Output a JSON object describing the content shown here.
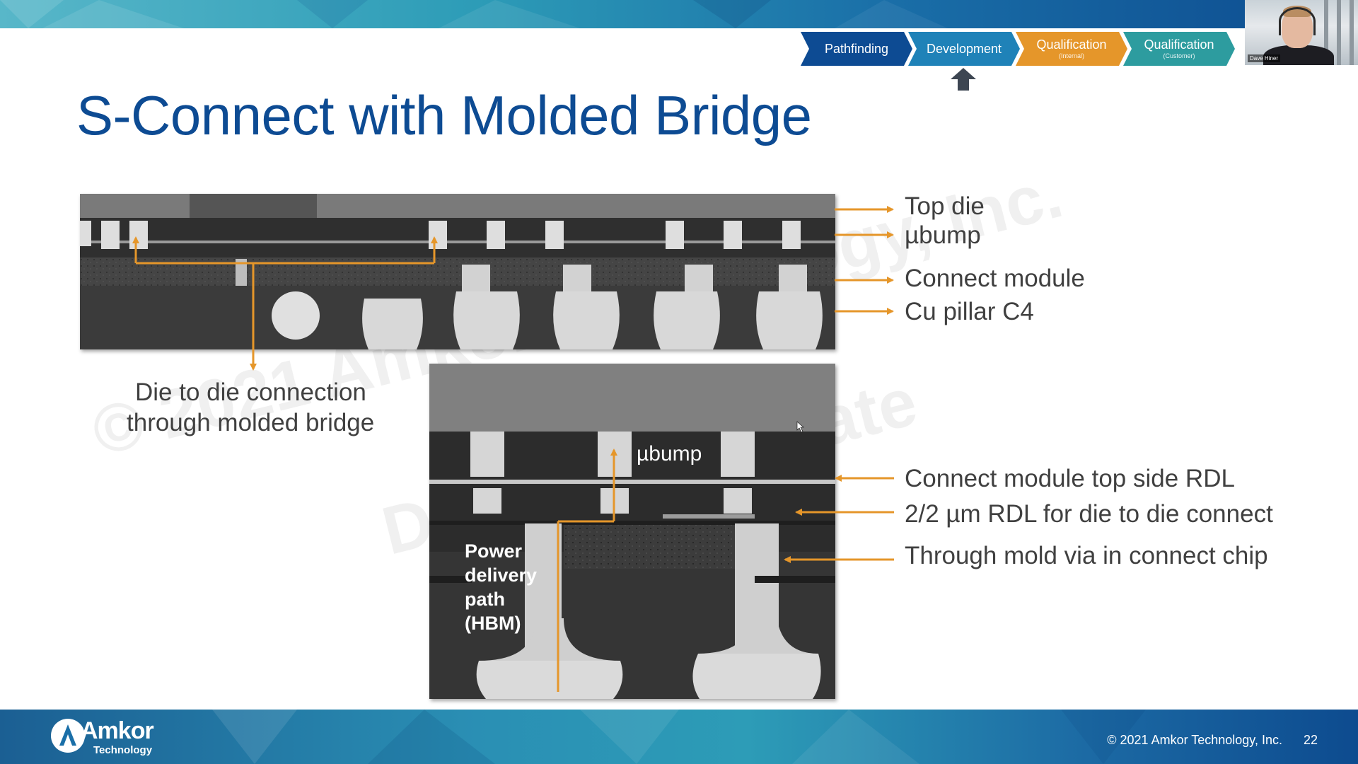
{
  "slide": {
    "title": "S-Connect with Molded Bridge",
    "page_number": "22",
    "copyright": "© 2021 Amkor Technology, Inc."
  },
  "stages": [
    {
      "label": "Pathfinding",
      "sub": "",
      "color": "#0d4b93"
    },
    {
      "label": "Development",
      "sub": "",
      "color": "#1f82b8"
    },
    {
      "label": "Qualification",
      "sub": "(Internal)",
      "color": "#e5962a"
    },
    {
      "label": "Qualification",
      "sub": "(Customer)",
      "color": "#2d9c9f"
    }
  ],
  "presenter": {
    "name": "Dave Hiner"
  },
  "watermark": {
    "line1": "© 2021 Amkor Technology, Inc.",
    "line2": "Do Not Duplicate"
  },
  "labels": {
    "top_die": "Top die",
    "ubump_right": "µbump",
    "connect_module": "Connect module",
    "cu_pillar": "Cu pillar C4",
    "d2d_line1": "Die to die connection",
    "d2d_line2": "through molded bridge",
    "ubump_image": "µbump",
    "power_line1": "Power",
    "power_line2": "delivery",
    "power_line3": "path",
    "power_line4": "(HBM)",
    "rdl_top": "Connect module top side RDL",
    "rdl_22": "2/2 µm RDL for die to die connect",
    "tmv": "Through mold via in connect chip"
  },
  "logo": {
    "brand": "Amkor",
    "sub": "Technology"
  },
  "colors": {
    "accent_orange": "#e5962a",
    "title_blue": "#0d4b93"
  }
}
